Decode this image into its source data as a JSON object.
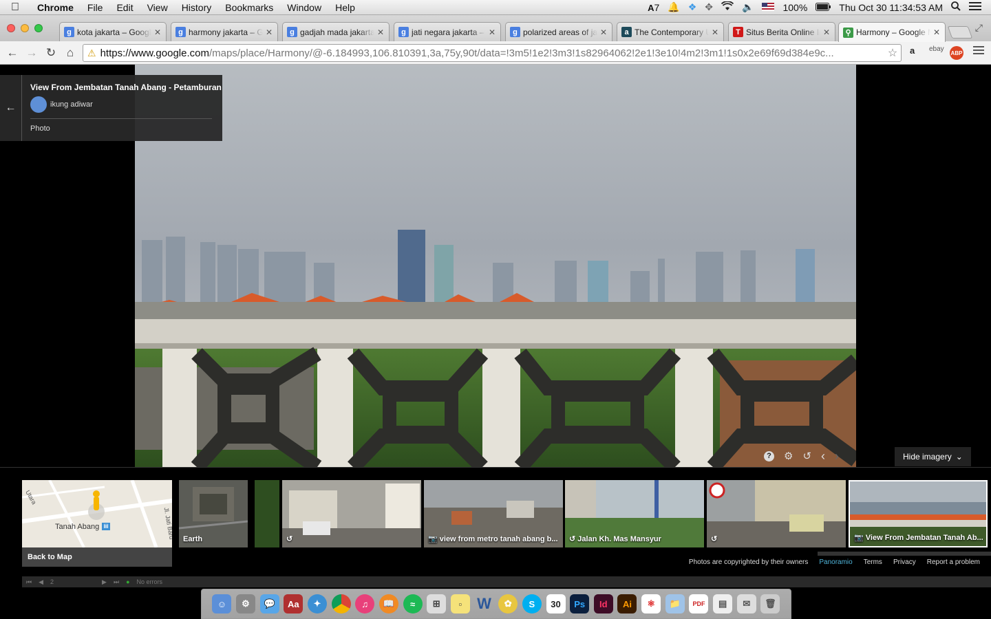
{
  "menubar": {
    "app": "Chrome",
    "menus": [
      "File",
      "Edit",
      "View",
      "History",
      "Bookmarks",
      "Window",
      "Help"
    ],
    "status": {
      "adobe_count": "7",
      "battery": "100%",
      "datetime": "Thu Oct 30  11:34:53 AM"
    }
  },
  "tabs": [
    {
      "title": "kota jakarta – Google",
      "favicon": "google-icon",
      "color": "#4a7fe0"
    },
    {
      "title": "harmony jakarta – Google",
      "favicon": "google-icon",
      "color": "#4a7fe0"
    },
    {
      "title": "gadjah mada jakarta",
      "favicon": "google-icon",
      "color": "#4a7fe0"
    },
    {
      "title": "jati negara jakarta –",
      "favicon": "google-icon",
      "color": "#4a7fe0"
    },
    {
      "title": "polarized areas of jakarta",
      "favicon": "google-icon",
      "color": "#4a7fe0"
    },
    {
      "title": "The Contemporary U",
      "favicon": "academia-icon",
      "color": "#1d4a5a"
    },
    {
      "title": "Situs Berita Online In",
      "favicon": "tempo-icon",
      "color": "#d01818"
    },
    {
      "title": "Harmony – Google M",
      "favicon": "maps-icon",
      "color": "#3c9a48"
    }
  ],
  "toolbar": {
    "url_host": "https://www.google.com",
    "url_path": "/maps/place/Harmony/@-6.184993,106.810391,3a,75y,90t/data=!3m5!1e2!3m3!1s82964062!2e1!3e10!4m2!3m1!1s0x2e69f69d384e9c..."
  },
  "infocard": {
    "title": "View From Jembatan Tanah Abang - Petamburan",
    "author": "ikung adiwar",
    "type": "Photo"
  },
  "controls": {
    "hide_imagery": "Hide imagery"
  },
  "thumbnails": [
    {
      "caption": "Back to Map",
      "map_label": "Tanah Abang",
      "street_a": "Utara",
      "street_b": "Jl. Jati Baru"
    },
    {
      "caption": "Earth"
    },
    {
      "caption": ""
    },
    {
      "caption": "view from metro tanah abang b..."
    },
    {
      "caption": "Jalan Kh. Mas Mansyur"
    },
    {
      "caption": ""
    },
    {
      "caption": "View From Jembatan Tanah Ab..."
    }
  ],
  "footer": {
    "copyright": "Photos are copyrighted by their owners",
    "panoramio": "Panoramio",
    "terms": "Terms",
    "privacy": "Privacy",
    "report": "Report a problem"
  },
  "devbar": {
    "page": "2",
    "errors": "No errors"
  },
  "dock": [
    "finder-icon",
    "system-preferences-icon",
    "messages-icon",
    "dictionary-icon",
    "safari-icon",
    "chrome-icon",
    "itunes-icon",
    "ibooks-icon",
    "spotify-icon",
    "calculator-icon",
    "stickies-icon",
    "word-icon",
    "aqualung-icon",
    "skype-icon",
    "calendar-icon",
    "photoshop-icon",
    "indesign-icon",
    "illustrator-icon",
    "acrobat-icon",
    "folder-icon",
    "pdf-icon",
    "preview-icon",
    "mail-icon",
    "trash-icon"
  ],
  "calendar_day": "30"
}
